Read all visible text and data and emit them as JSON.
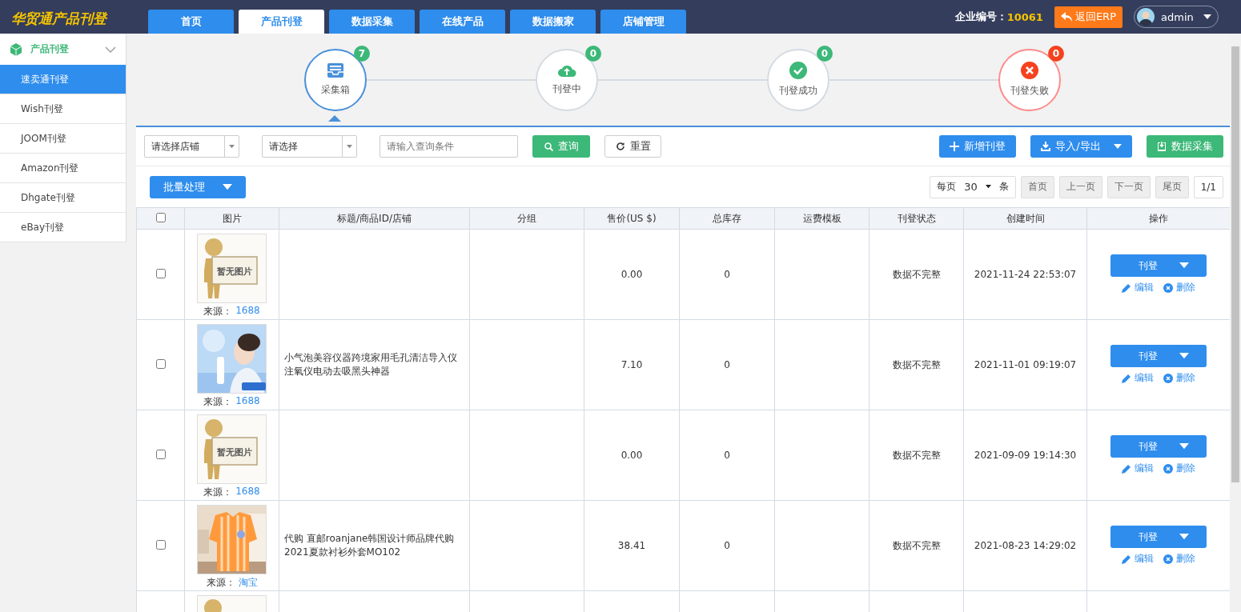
{
  "header": {
    "logo": "华贸通产品刊登",
    "tabs": [
      {
        "label": "首页",
        "selected": false
      },
      {
        "label": "产品刊登",
        "selected": true
      },
      {
        "label": "数据采集",
        "selected": false
      },
      {
        "label": "在线产品",
        "selected": false
      },
      {
        "label": "数据搬家",
        "selected": false
      },
      {
        "label": "店铺管理",
        "selected": false
      }
    ],
    "company_label": "企业编号：",
    "company_id": "10061",
    "back_button": "返回ERP",
    "user": "admin"
  },
  "sidebar": {
    "title": "产品刊登",
    "expanded": true,
    "items": [
      {
        "label": "速卖通刊登",
        "selected": true
      },
      {
        "label": "Wish刊登",
        "selected": false
      },
      {
        "label": "JOOM刊登",
        "selected": false
      },
      {
        "label": "Amazon刊登",
        "selected": false
      },
      {
        "label": "Dhgate刊登",
        "selected": false
      },
      {
        "label": "eBay刊登",
        "selected": false
      }
    ]
  },
  "steps": [
    {
      "kind": "inbox",
      "label": "采集箱",
      "count": "7",
      "color": "#3cb878",
      "selected": true
    },
    {
      "kind": "upload",
      "label": "刊登中",
      "count": "0",
      "color": "#3cb878",
      "selected": false
    },
    {
      "kind": "success",
      "label": "刊登成功",
      "count": "0",
      "color": "#3cb878",
      "selected": false
    },
    {
      "kind": "failed",
      "label": "刊登失败",
      "count": "0",
      "color": "#f5421e",
      "selected": false
    }
  ],
  "filters": {
    "shop_select": "请选择店铺",
    "select": "请选择",
    "search_placeholder": "请输入查询条件",
    "search_button": "查询",
    "reset_button": "重置"
  },
  "actions": {
    "add": "新增刊登",
    "import_export": "导入/导出",
    "collect": "数据采集",
    "batch": "批量处理"
  },
  "pager": {
    "per_page_label": "每页",
    "per_page": "30",
    "per_page_unit": "条",
    "buttons": [
      {
        "label": "首页",
        "disabled": true
      },
      {
        "label": "上一页",
        "disabled": true
      },
      {
        "label": "下一页",
        "disabled": true
      },
      {
        "label": "尾页",
        "disabled": true
      }
    ],
    "page_info": "1/1"
  },
  "table": {
    "select_all": false,
    "columns": [
      "图片",
      "标题/商品ID/店铺",
      "分组",
      "售价(US $)",
      "总库存",
      "运费模板",
      "刊登状态",
      "创建时间",
      "操作"
    ],
    "rows": [
      {
        "checked": false,
        "image": {
          "kind": "placeholder",
          "text": "暂无图片"
        },
        "source_label": "来源：",
        "source": "1688",
        "price": "0.00",
        "stock": "0",
        "status": "数据不完整",
        "created": "2021-11-24 22:53:07",
        "action": "刊登",
        "edit": "编辑",
        "delete": "删除"
      },
      {
        "checked": false,
        "source_label": "来源：",
        "source": "1688",
        "title": "小气泡美容仪器跨境家用毛孔清洁导入仪注氧仪电动去吸黑头神器",
        "price": "7.10",
        "stock": "0",
        "status": "数据不完整",
        "created": "2021-11-01 09:19:07",
        "action": "刊登",
        "edit": "编辑",
        "delete": "删除"
      },
      {
        "checked": false,
        "image": {
          "kind": "placeholder",
          "text": "暂无图片"
        },
        "source_label": "来源：",
        "source": "1688",
        "price": "0.00",
        "stock": "0",
        "status": "数据不完整",
        "created": "2021-09-09 19:14:30",
        "action": "刊登",
        "edit": "编辑",
        "delete": "删除"
      },
      {
        "checked": false,
        "source_label": "来源：",
        "source": "淘宝",
        "title": "代购 直邮roanjane韩国设计师品牌代购2021夏款衬衫外套MO102",
        "price": "38.41",
        "stock": "0",
        "status": "数据不完整",
        "created": "2021-08-23 14:29:02",
        "action": "刊登",
        "edit": "编辑",
        "delete": "删除"
      },
      {
        "image": {
          "kind": "placeholder"
        }
      }
    ]
  }
}
